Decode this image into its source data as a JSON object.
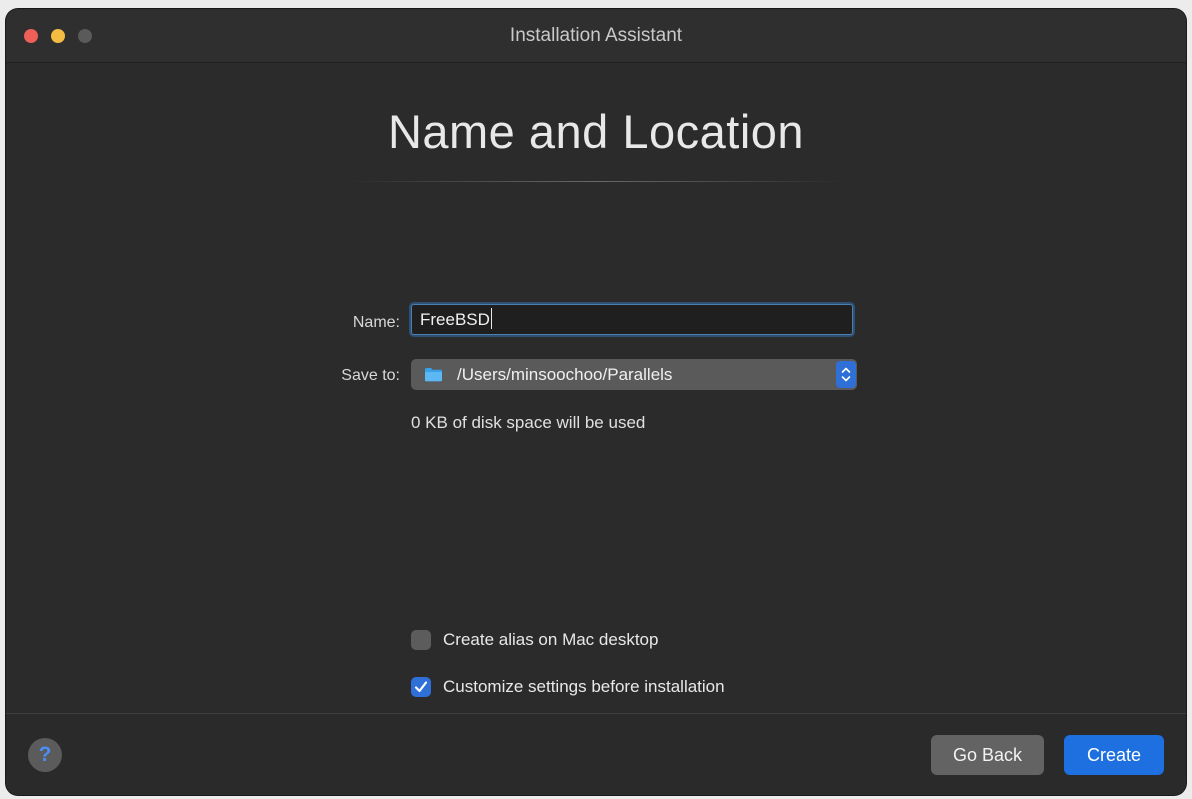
{
  "window": {
    "title": "Installation Assistant"
  },
  "page": {
    "title": "Name and Location"
  },
  "form": {
    "name_label": "Name:",
    "name_value": "FreeBSD",
    "save_label": "Save to:",
    "save_path": "/Users/minsoochoo/Parallels",
    "disk_note": "0 KB of disk space will be used"
  },
  "options": [
    {
      "label": "Create alias on Mac desktop",
      "checked": false
    },
    {
      "label": "Customize settings before installation",
      "checked": true
    }
  ],
  "footer": {
    "help_label": "?",
    "back_label": "Go Back",
    "create_label": "Create"
  },
  "colors": {
    "accent": "#1e6fe0",
    "close": "#ee5f57",
    "minimize": "#f4bd41",
    "window_bg": "#2b2b2b"
  },
  "icons": {
    "folder": "folder-icon",
    "stepper": "up-down-chevron-icon",
    "checkmark": "checkmark-icon"
  }
}
